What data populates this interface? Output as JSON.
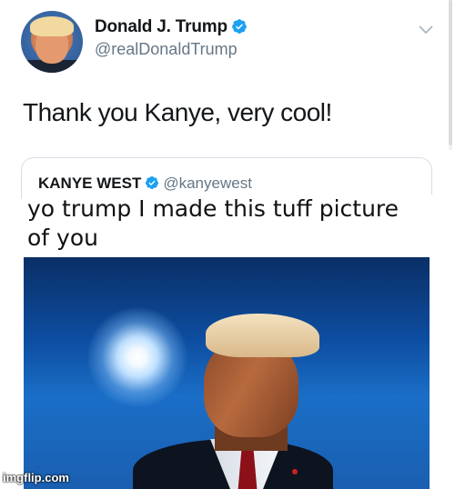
{
  "tweet": {
    "display_name": "Donald J. Trump",
    "handle": "@realDonaldTrump",
    "text": "Thank you Kanye, very cool!"
  },
  "quoted_tweet": {
    "display_name": "KANYE WEST",
    "handle": "@kanyewest"
  },
  "caption": {
    "line1": "yo trump I made this tuff picture",
    "line2": "of you"
  },
  "watermark": "imgflip.com",
  "icons": {
    "verified": "verified-badge-icon",
    "menu": "chevron-down-icon"
  },
  "colors": {
    "verified_blue": "#1da1f2",
    "handle_gray": "#657786",
    "sky_blue": "#1a6ec7"
  }
}
